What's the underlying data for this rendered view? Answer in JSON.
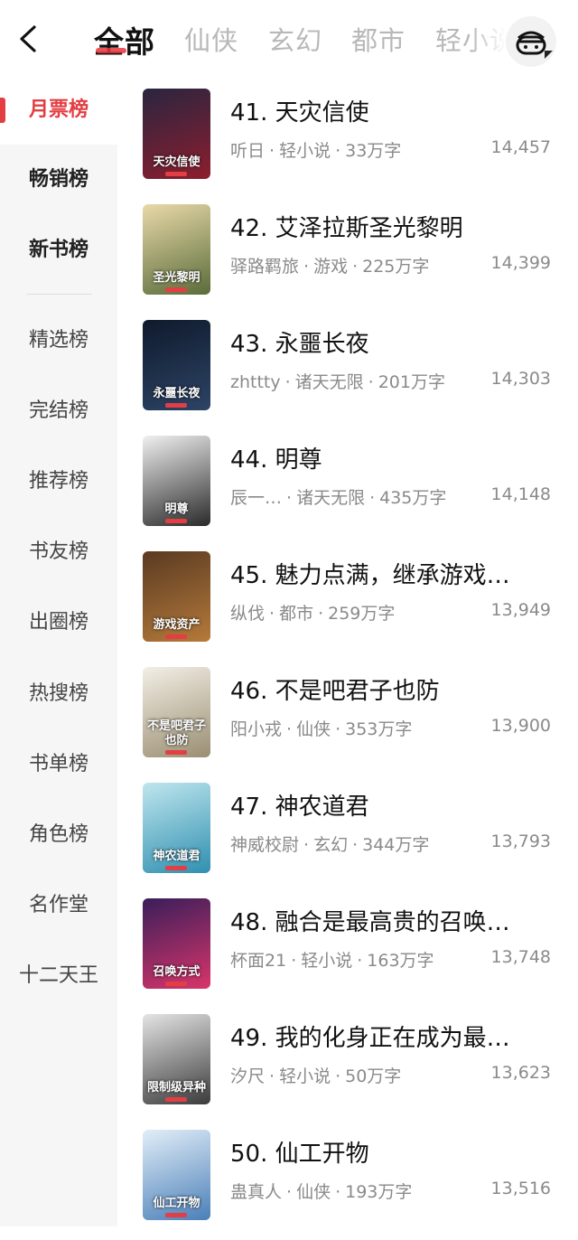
{
  "header": {
    "tabs": [
      {
        "label": "全部",
        "active": true
      },
      {
        "label": "仙侠",
        "active": false
      },
      {
        "label": "玄幻",
        "active": false
      },
      {
        "label": "都市",
        "active": false
      },
      {
        "label": "轻小说",
        "active": false
      }
    ],
    "accent_color": "#e33e43"
  },
  "sidebar": {
    "items": [
      {
        "label": "月票榜"
      },
      {
        "label": "畅销榜"
      },
      {
        "label": "新书榜"
      },
      {
        "label": "精选榜"
      },
      {
        "label": "完结榜"
      },
      {
        "label": "推荐榜"
      },
      {
        "label": "书友榜"
      },
      {
        "label": "出圈榜"
      },
      {
        "label": "热搜榜"
      },
      {
        "label": "书单榜"
      },
      {
        "label": "角色榜"
      },
      {
        "label": "名作堂"
      },
      {
        "label": "十二天王"
      }
    ]
  },
  "books": [
    {
      "title": "41. 天灾信使",
      "author": "听日",
      "genre": "轻小说",
      "words": "33万字",
      "count": "14,457",
      "cover_text": "天灾信使",
      "cover_colors": [
        "#2a2540",
        "#8c1e2e"
      ]
    },
    {
      "title": "42. 艾泽拉斯圣光黎明",
      "author": "驿路羁旅",
      "genre": "游戏",
      "words": "225万字",
      "count": "14,399",
      "cover_text": "圣光黎明",
      "cover_colors": [
        "#e9d9a8",
        "#5a6b3a"
      ]
    },
    {
      "title": "43. 永噩长夜",
      "author": "zhttty",
      "genre": "诸天无限",
      "words": "201万字",
      "count": "14,303",
      "cover_text": "永噩长夜",
      "cover_colors": [
        "#0f1a2c",
        "#2d4466"
      ]
    },
    {
      "title": "44. 明尊",
      "author": "辰一…",
      "genre": "诸天无限",
      "words": "435万字",
      "count": "14,148",
      "cover_text": "明尊",
      "cover_colors": [
        "#f0f0f0",
        "#2a2a2a"
      ]
    },
    {
      "title": "45. 魅力点满，继承游戏…",
      "author": "纵伐",
      "genre": "都市",
      "words": "259万字",
      "count": "13,949",
      "cover_text": "游戏资产",
      "cover_colors": [
        "#5a3a22",
        "#b57a3a"
      ]
    },
    {
      "title": "46. 不是吧君子也防",
      "author": "阳小戎",
      "genre": "仙侠",
      "words": "353万字",
      "count": "13,900",
      "cover_text": "不是吧君子也防",
      "cover_colors": [
        "#f3efe6",
        "#9a8e72"
      ]
    },
    {
      "title": "47. 神农道君",
      "author": "神威校尉",
      "genre": "玄幻",
      "words": "344万字",
      "count": "13,793",
      "cover_text": "神农道君",
      "cover_colors": [
        "#bfe6ee",
        "#2f8fb0"
      ]
    },
    {
      "title": "48. 融合是最高贵的召唤…",
      "author": "杯面21",
      "genre": "轻小说",
      "words": "163万字",
      "count": "13,748",
      "cover_text": "召唤方式",
      "cover_colors": [
        "#3a1e5a",
        "#d8356a"
      ]
    },
    {
      "title": "49. 我的化身正在成为最…",
      "author": "汐尺",
      "genre": "轻小说",
      "words": "50万字",
      "count": "13,623",
      "cover_text": "限制级异种",
      "cover_colors": [
        "#e4e4e4",
        "#3b3b3b"
      ]
    },
    {
      "title": "50. 仙工开物",
      "author": "蛊真人",
      "genre": "仙侠",
      "words": "193万字",
      "count": "13,516",
      "cover_text": "仙工开物",
      "cover_colors": [
        "#e2eef8",
        "#4a7fb8"
      ]
    }
  ]
}
